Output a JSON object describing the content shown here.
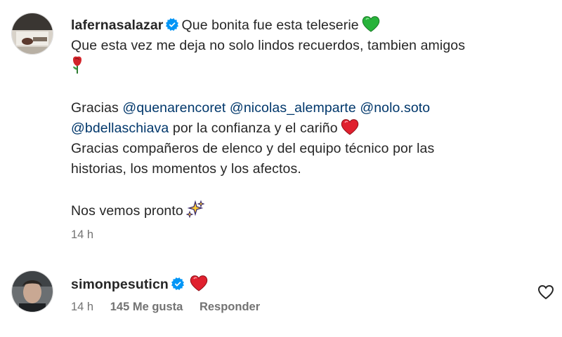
{
  "comments": [
    {
      "username": "lafernasalazar",
      "lines": {
        "l1_text": "Que bonita fue esta teleserie",
        "l2_text": "Que esta vez me deja no solo lindos recuerdos, tambien amigos",
        "l4_prefix": "Gracias",
        "mention1": "@quenarencoret",
        "mention2": "@nicolas_alemparte",
        "mention3": "@nolo.soto",
        "mention4": "@bdellaschiava",
        "l5_suffix": "por la confianza y el cariño",
        "l6_text": "Gracias compañeros de elenco y del equipo técnico por las",
        "l7_text": "historias, los momentos y los afectos.",
        "l9_text": "Nos vemos pronto"
      },
      "emojis": [
        "green-heart-icon",
        "rose-icon",
        "red-heart-icon",
        "sparkles-icon"
      ],
      "time": "14 h"
    },
    {
      "username": "simonpesuticn",
      "emojis": [
        "red-heart-icon"
      ],
      "time": "14 h",
      "likes": "145 Me gusta",
      "reply": "Responder"
    }
  ],
  "colors": {
    "text": "#262626",
    "muted": "#737373",
    "mention": "#00376b",
    "verified": "#0095f6"
  }
}
